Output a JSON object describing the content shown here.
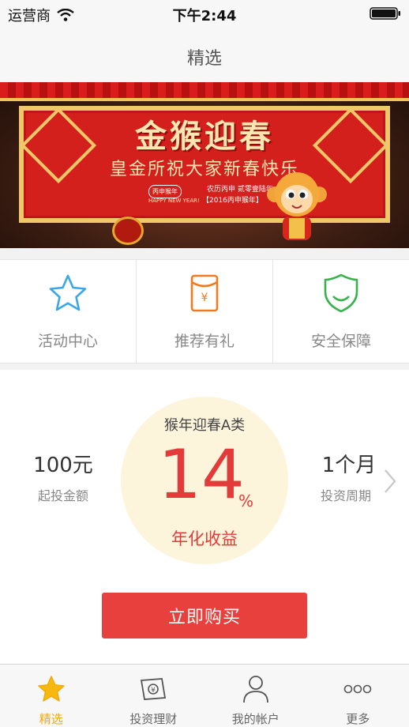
{
  "status_bar": {
    "carrier": "运营商",
    "time": "下午2:44"
  },
  "nav": {
    "title": "精选"
  },
  "banner": {
    "title": "金猴迎春",
    "subtitle": "皇金所祝大家新春快乐",
    "seal": "丙申猴年",
    "seal_en": "HAPPY NEW YEAR!",
    "date_line1": "农历丙申  贰零壹陆年",
    "date_line2": "【2016丙申猴年】",
    "pages": 5,
    "active_page": 0
  },
  "features": [
    {
      "label": "活动中心",
      "icon": "star-icon"
    },
    {
      "label": "推荐有礼",
      "icon": "red-envelope-icon"
    },
    {
      "label": "安全保障",
      "icon": "shield-icon"
    }
  ],
  "product": {
    "name": "猴年迎春A类",
    "rate": "14",
    "rate_unit": "%",
    "rate_label": "年化收益",
    "min_amount": "100元",
    "min_label": "起投金额",
    "period": "1个月",
    "period_label": "投资周期",
    "buy_label": "立即购买"
  },
  "tabs": [
    {
      "label": "精选",
      "icon": "star-icon",
      "active": true
    },
    {
      "label": "投资理财",
      "icon": "money-bill-icon",
      "active": false
    },
    {
      "label": "我的帐户",
      "icon": "person-icon",
      "active": false
    },
    {
      "label": "更多",
      "icon": "more-dots-icon",
      "active": false
    }
  ],
  "colors": {
    "accent": "#f4a80a",
    "primary_red": "#e8403c",
    "rate_circle": "#fdf4dc"
  }
}
